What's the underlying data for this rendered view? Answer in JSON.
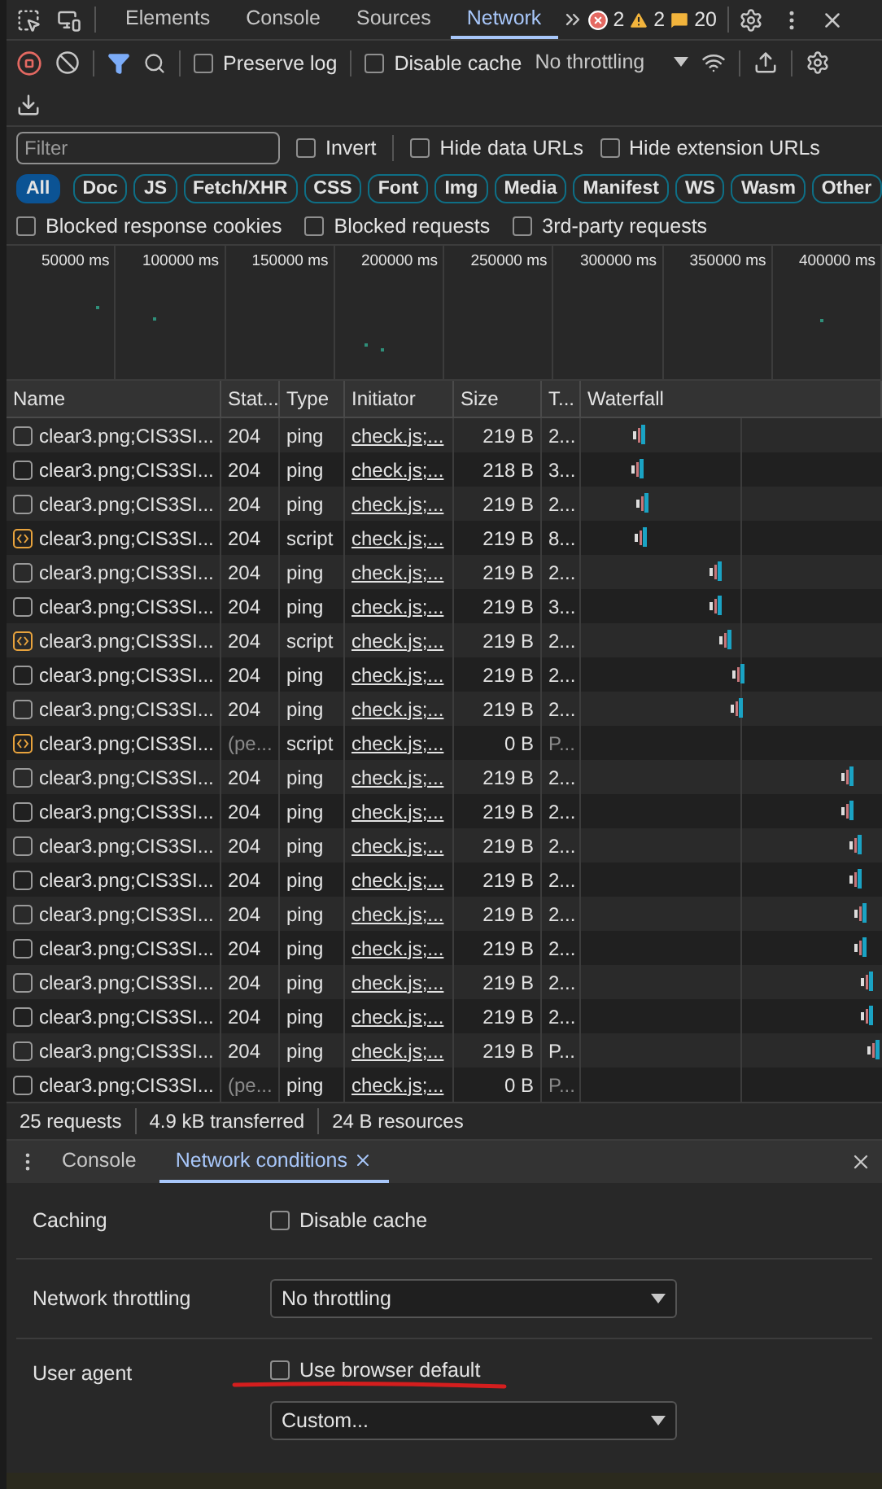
{
  "main_tabs": [
    {
      "label": "Elements",
      "selected": false
    },
    {
      "label": "Console",
      "selected": false
    },
    {
      "label": "Sources",
      "selected": false
    },
    {
      "label": "Network",
      "selected": true
    }
  ],
  "counters": [
    {
      "kind": "error",
      "count": "2"
    },
    {
      "kind": "warning",
      "count": "2"
    },
    {
      "kind": "issue",
      "count": "20"
    }
  ],
  "toolbar": {
    "recording": true,
    "preserve_log": {
      "label": "Preserve log",
      "checked": false
    },
    "disable_cache": {
      "label": "Disable cache",
      "checked": false
    },
    "throttling": "No throttling"
  },
  "filter": {
    "placeholder": "Filter",
    "options": [
      {
        "label": "Invert",
        "checked": false
      },
      {
        "label": "Hide data URLs",
        "checked": false
      },
      {
        "label": "Hide extension URLs",
        "checked": false
      }
    ]
  },
  "type_chips": [
    {
      "label": "All",
      "selected": true
    },
    {
      "label": "Doc",
      "selected": false
    },
    {
      "label": "JS",
      "selected": false
    },
    {
      "label": "Fetch/XHR",
      "selected": false
    },
    {
      "label": "CSS",
      "selected": false
    },
    {
      "label": "Font",
      "selected": false
    },
    {
      "label": "Img",
      "selected": false
    },
    {
      "label": "Media",
      "selected": false
    },
    {
      "label": "Manifest",
      "selected": false
    },
    {
      "label": "WS",
      "selected": false
    },
    {
      "label": "Wasm",
      "selected": false
    },
    {
      "label": "Other",
      "selected": false
    }
  ],
  "blocked_options": [
    {
      "label": "Blocked response cookies",
      "checked": false
    },
    {
      "label": "Blocked requests",
      "checked": false
    },
    {
      "label": "3rd-party requests",
      "checked": false
    }
  ],
  "overview": {
    "ticks": [
      "50000 ms",
      "100000 ms",
      "150000 ms",
      "200000 ms",
      "250000 ms",
      "300000 ms",
      "350000 ms",
      "400000 ms"
    ]
  },
  "table": {
    "columns": [
      "Name",
      "Stat...",
      "Type",
      "Initiator",
      "Size",
      "T...",
      "Waterfall"
    ],
    "rows": [
      {
        "kind": "ping",
        "name": "clear3.png;CIS3SI...",
        "status": "204",
        "type": "ping",
        "initiator": "check.js;...",
        "size": "219 B",
        "time": "2...",
        "pending": false
      },
      {
        "kind": "ping",
        "name": "clear3.png;CIS3SI...",
        "status": "204",
        "type": "ping",
        "initiator": "check.js;...",
        "size": "218 B",
        "time": "3...",
        "pending": false
      },
      {
        "kind": "ping",
        "name": "clear3.png;CIS3SI...",
        "status": "204",
        "type": "ping",
        "initiator": "check.js;...",
        "size": "219 B",
        "time": "2...",
        "pending": false
      },
      {
        "kind": "script",
        "name": "clear3.png;CIS3SI...",
        "status": "204",
        "type": "script",
        "initiator": "check.js;...",
        "size": "219 B",
        "time": "8...",
        "pending": false
      },
      {
        "kind": "ping",
        "name": "clear3.png;CIS3SI...",
        "status": "204",
        "type": "ping",
        "initiator": "check.js;...",
        "size": "219 B",
        "time": "2...",
        "pending": false
      },
      {
        "kind": "ping",
        "name": "clear3.png;CIS3SI...",
        "status": "204",
        "type": "ping",
        "initiator": "check.js;...",
        "size": "219 B",
        "time": "3...",
        "pending": false
      },
      {
        "kind": "script",
        "name": "clear3.png;CIS3SI...",
        "status": "204",
        "type": "script",
        "initiator": "check.js;...",
        "size": "219 B",
        "time": "2...",
        "pending": false
      },
      {
        "kind": "ping",
        "name": "clear3.png;CIS3SI...",
        "status": "204",
        "type": "ping",
        "initiator": "check.js;...",
        "size": "219 B",
        "time": "2...",
        "pending": false
      },
      {
        "kind": "ping",
        "name": "clear3.png;CIS3SI...",
        "status": "204",
        "type": "ping",
        "initiator": "check.js;...",
        "size": "219 B",
        "time": "2...",
        "pending": false
      },
      {
        "kind": "script",
        "name": "clear3.png;CIS3SI...",
        "status": "(pe...",
        "type": "script",
        "initiator": "check.js;...",
        "size": "0 B",
        "time": "P...",
        "pending": true
      },
      {
        "kind": "ping",
        "name": "clear3.png;CIS3SI...",
        "status": "204",
        "type": "ping",
        "initiator": "check.js;...",
        "size": "219 B",
        "time": "2...",
        "pending": false
      },
      {
        "kind": "ping",
        "name": "clear3.png;CIS3SI...",
        "status": "204",
        "type": "ping",
        "initiator": "check.js;...",
        "size": "219 B",
        "time": "2...",
        "pending": false
      },
      {
        "kind": "ping",
        "name": "clear3.png;CIS3SI...",
        "status": "204",
        "type": "ping",
        "initiator": "check.js;...",
        "size": "219 B",
        "time": "2...",
        "pending": false
      },
      {
        "kind": "ping",
        "name": "clear3.png;CIS3SI...",
        "status": "204",
        "type": "ping",
        "initiator": "check.js;...",
        "size": "219 B",
        "time": "2...",
        "pending": false
      },
      {
        "kind": "ping",
        "name": "clear3.png;CIS3SI...",
        "status": "204",
        "type": "ping",
        "initiator": "check.js;...",
        "size": "219 B",
        "time": "2...",
        "pending": false
      },
      {
        "kind": "ping",
        "name": "clear3.png;CIS3SI...",
        "status": "204",
        "type": "ping",
        "initiator": "check.js;...",
        "size": "219 B",
        "time": "2...",
        "pending": false
      },
      {
        "kind": "ping",
        "name": "clear3.png;CIS3SI...",
        "status": "204",
        "type": "ping",
        "initiator": "check.js;...",
        "size": "219 B",
        "time": "2...",
        "pending": false
      },
      {
        "kind": "ping",
        "name": "clear3.png;CIS3SI...",
        "status": "204",
        "type": "ping",
        "initiator": "check.js;...",
        "size": "219 B",
        "time": "2...",
        "pending": false
      },
      {
        "kind": "ping",
        "name": "clear3.png;CIS3SI...",
        "status": "204",
        "type": "ping",
        "initiator": "check.js;...",
        "size": "219 B",
        "time": "P...",
        "pending": false
      },
      {
        "kind": "ping",
        "name": "clear3.png;CIS3SI...",
        "status": "(pe...",
        "type": "ping",
        "initiator": "check.js;...",
        "size": "0 B",
        "time": "P...",
        "pending": true
      }
    ]
  },
  "status_bar": [
    "25 requests",
    "4.9 kB transferred",
    "24 B resources"
  ],
  "drawer_tabs": [
    {
      "label": "Console",
      "selected": false,
      "closable": false
    },
    {
      "label": "Network conditions",
      "selected": true,
      "closable": true
    }
  ],
  "conditions": {
    "caching": {
      "label": "Caching",
      "option": {
        "label": "Disable cache",
        "checked": false
      }
    },
    "throttling": {
      "label": "Network throttling",
      "value": "No throttling"
    },
    "user_agent": {
      "label": "User agent",
      "option": {
        "label": "Use browser default",
        "checked": false
      },
      "value": "Custom...",
      "underlined": true
    }
  }
}
